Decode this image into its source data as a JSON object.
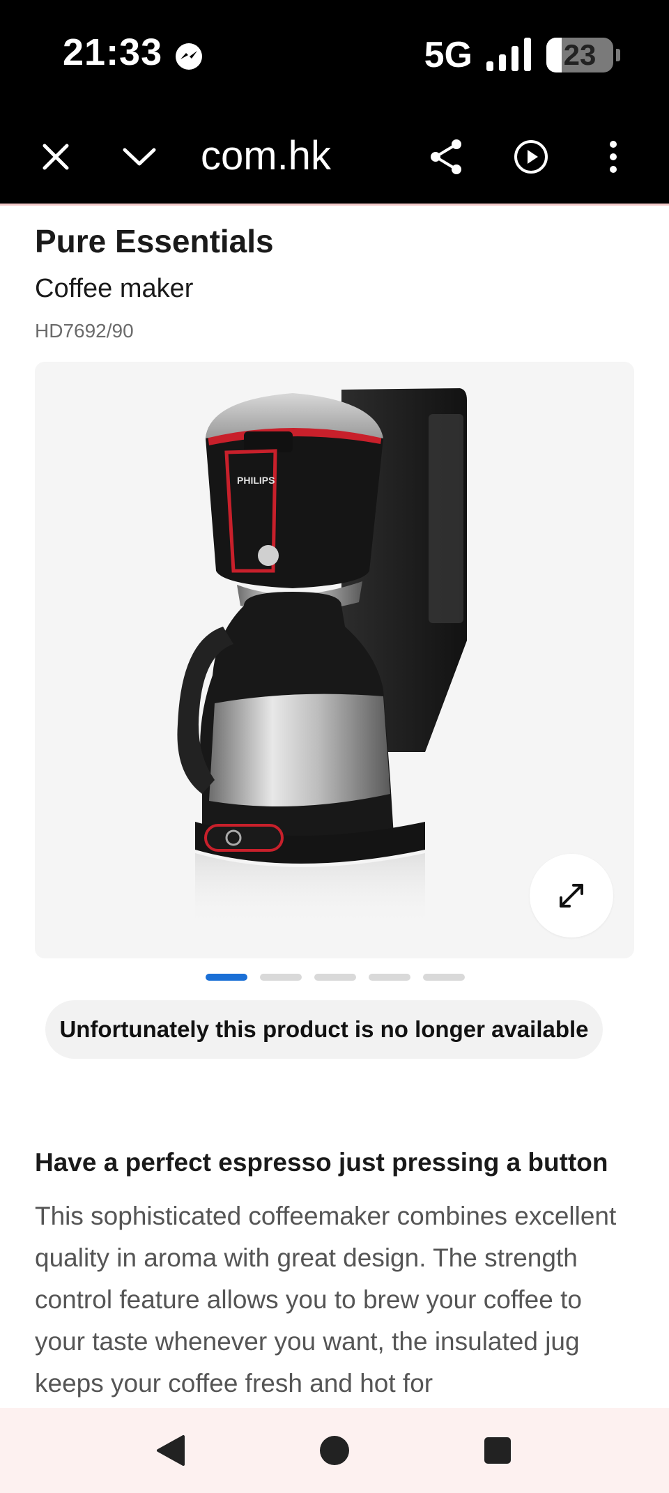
{
  "status_bar": {
    "time": "21:33",
    "network": "5G",
    "battery": "23",
    "icons": [
      "messenger-icon",
      "signal-icon",
      "battery-icon"
    ]
  },
  "browser": {
    "url": "com.hk",
    "icons": [
      "close-icon",
      "chevron-down-icon",
      "share-icon",
      "play-icon",
      "more-vertical-icon"
    ]
  },
  "product": {
    "title": "Pure Essentials",
    "subtitle": "Coffee maker",
    "sku": "HD7692/90",
    "image_brand_text": "PHILIPS",
    "gallery_total": 5,
    "gallery_active": 1,
    "availability": "Unfortunately this product is no longer available"
  },
  "description": {
    "heading": "Have a perfect espresso just pressing a button",
    "body": "This sophisticated coffeemaker combines excellent quality in aroma with great design. The strength control feature allows you to brew your coffee to your taste whenever you want, the insulated jug keeps your coffee fresh and hot for"
  },
  "colors": {
    "accent": "#1a6fd6",
    "product_red": "#c8202b"
  },
  "nav": {
    "icons": [
      "back-icon",
      "home-icon",
      "recents-icon"
    ]
  }
}
